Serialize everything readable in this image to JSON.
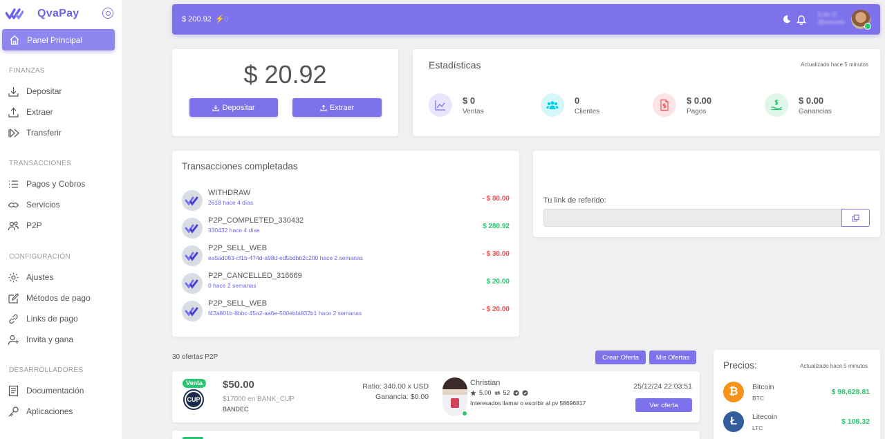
{
  "brand": {
    "name": "QvaPay"
  },
  "sidebar": {
    "active": {
      "label": "Panel Principal",
      "icon": "home-icon"
    },
    "sections": [
      {
        "title": "FINANZAS",
        "items": [
          {
            "label": "Depositar",
            "icon": "download-icon"
          },
          {
            "label": "Extraer",
            "icon": "upload-icon"
          },
          {
            "label": "Transferir",
            "icon": "transfer-icon"
          }
        ]
      },
      {
        "title": "TRANSACCIONES",
        "items": [
          {
            "label": "Pagos y Cobros",
            "icon": "list-icon"
          },
          {
            "label": "Servicios",
            "icon": "services-icon"
          },
          {
            "label": "P2P",
            "icon": "users-icon"
          }
        ]
      },
      {
        "title": "CONFIGURACIÓN",
        "items": [
          {
            "label": "Ajustes",
            "icon": "gear-icon"
          },
          {
            "label": "Métodos de pago",
            "icon": "edit-icon"
          },
          {
            "label": "Links de pago",
            "icon": "link-icon"
          },
          {
            "label": "Invita y gana",
            "icon": "user-plus-icon"
          }
        ]
      },
      {
        "title": "DESARROLLADORES",
        "items": [
          {
            "label": "Documentación",
            "icon": "document-icon"
          },
          {
            "label": "Aplicaciones",
            "icon": "key-icon"
          }
        ]
      }
    ]
  },
  "topbar": {
    "balance": "$ 200.92",
    "bolt_value": "0",
    "user_name": "Erlin D",
    "user_handle": "@erenelo"
  },
  "balance_card": {
    "amount": "$ 20.92",
    "deposit_label": "Depositar",
    "withdraw_label": "Extraer"
  },
  "stats": {
    "title": "Estadísticas",
    "updated": "Actualizado hace 5 minutos",
    "items": [
      {
        "value": "$ 0",
        "label": "Ventas",
        "icon": "trending-up-icon",
        "color": "#e9e7fd"
      },
      {
        "value": "0",
        "label": "Clientes",
        "icon": "users-icon",
        "color": "#d6f7fa"
      },
      {
        "value": "$ 0.00",
        "label": "Pagos",
        "icon": "invoice-icon",
        "color": "#fce4e4"
      },
      {
        "value": "$ 0.00",
        "label": "Ganancias",
        "icon": "money-hand-icon",
        "color": "#dff7e9"
      }
    ]
  },
  "transactions": {
    "title": "Transacciones completadas",
    "items": [
      {
        "title": "WITHDRAW",
        "sub": "2618 hace 4 días",
        "amount": "- $ 80.00",
        "sign": "neg"
      },
      {
        "title": "P2P_COMPLETED_330432",
        "sub": "330432 hace 4 días",
        "amount": "$ 280.92",
        "sign": "pos"
      },
      {
        "title": "P2P_SELL_WEB",
        "sub": "ea5ad083-cf1b-474d-a98d-ed5bdbb2c200 hace 2 semanas",
        "amount": "- $ 30.00",
        "sign": "neg"
      },
      {
        "title": "P2P_CANCELLED_316669",
        "sub": "0 hace 2 semanas",
        "amount": "$ 20.00",
        "sign": "pos"
      },
      {
        "title": "P2P_SELL_WEB",
        "sub": "f42a801b-8bbc-45a2-aa6e-500ebfa832b1 hace 2 semanas",
        "amount": "- $ 20.00",
        "sign": "neg"
      }
    ]
  },
  "referral": {
    "label": "Tu link de referido:",
    "value": ""
  },
  "offers": {
    "count": "30 ofertas P2P",
    "create_label": "Crear Oferta",
    "mine_label": "Mis Ofertas",
    "items": [
      {
        "badge": "Venta",
        "coin_logo": "CUP",
        "price": "$50.00",
        "desc": "$17000 en BANK_CUP",
        "bank": "BANDEC",
        "ratio": "Ratio: 340.00 x USD",
        "gain": "Ganancia: $0.00",
        "seller": "Christian",
        "rating": "5.00",
        "trades": "52",
        "note": "Interesados llamar o escribir al pv 58696817",
        "date": "25/12/24 22:03:51",
        "button": "Ver oferta"
      }
    ]
  },
  "prices": {
    "title": "Precios:",
    "updated": "Actualizado hace 5 minutos",
    "coins": [
      {
        "name": "Bitcoin",
        "symbol": "BTC",
        "price": "$ 98,628.81",
        "color": "#f7931a",
        "glyph": "₿"
      },
      {
        "name": "Litecoin",
        "symbol": "LTC",
        "price": "$ 108.32",
        "color": "#345d9d",
        "glyph": "Ł"
      }
    ]
  }
}
